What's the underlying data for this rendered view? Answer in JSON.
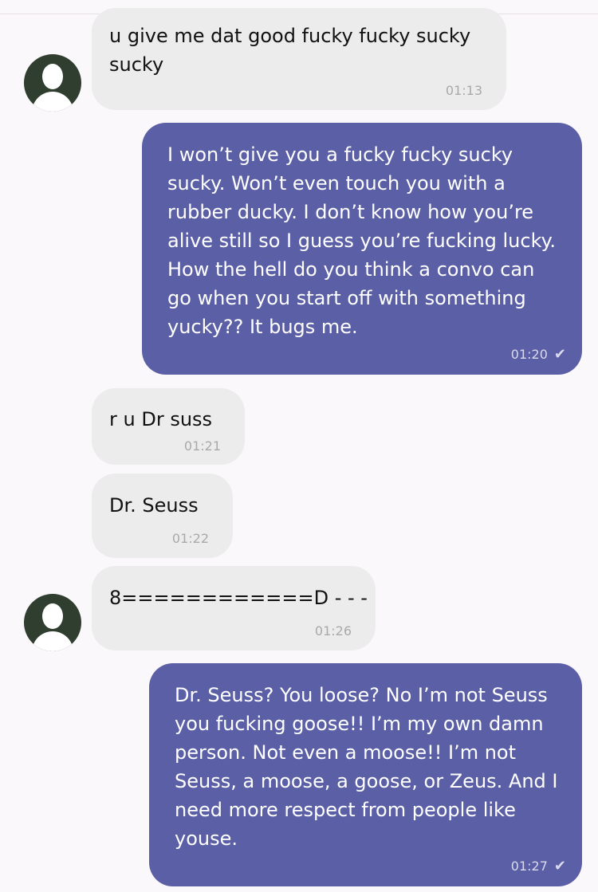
{
  "messages": [
    {
      "text": "u give me dat good fucky fucky sucky\nsucky",
      "time": "01:13"
    },
    {
      "text": "I won’t give you a fucky fucky sucky\nsucky. Won’t even touch you with a\nrubber ducky. I don’t know how you’re\nalive still so I guess you’re fucking lucky.\nHow the hell do you think a convo can\ngo when you start off with something\nyucky?? It bugs me.",
      "time": "01:20",
      "status": "✔"
    },
    {
      "text": "r u Dr suss",
      "time": "01:21"
    },
    {
      "text": "Dr. Seuss",
      "time": "01:22"
    },
    {
      "text": "8============D - - -",
      "time": "01:26"
    },
    {
      "text": "Dr. Seuss? You loose? No I’m not Seuss\nyou fucking goose!! I’m my own damn\nperson. Not even a moose!! I’m not\nSeuss, a moose, a goose, or Zeus. And I\nneed more respect from people like\nyouse.",
      "time": "01:27",
      "status": "✔"
    }
  ],
  "icons": {
    "avatar": "person-silhouette-icon",
    "read_receipt": "checkmark-icon"
  },
  "colors": {
    "incoming_bubble": "#ececec",
    "outgoing_bubble": "#5b5fa5",
    "avatar_bg": "#2f3e2e",
    "background": "#fbf8fb"
  }
}
